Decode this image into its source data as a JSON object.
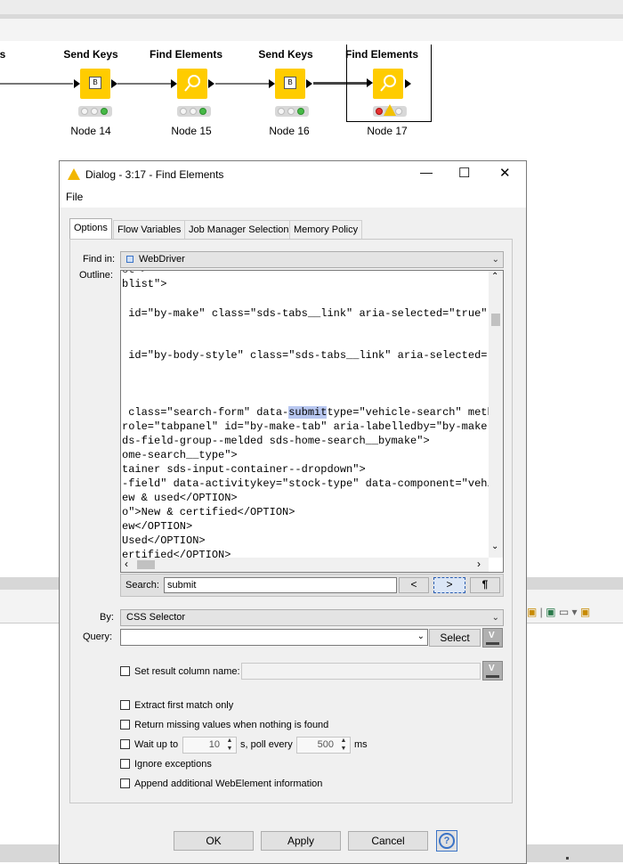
{
  "canvas": {
    "partial_node_title": "s",
    "nodes": [
      {
        "title": "Send Keys",
        "label": "Node 14",
        "icon": "keyboard-icon"
      },
      {
        "title": "Find Elements",
        "label": "Node 15",
        "icon": "find-elements-icon"
      },
      {
        "title": "Send Keys",
        "label": "Node 16",
        "icon": "keyboard-icon"
      },
      {
        "title": "Find Elements",
        "label": "Node 17",
        "icon": "find-elements-icon"
      }
    ]
  },
  "dialog": {
    "title": "Dialog - 3:17 - Find Elements",
    "menu": {
      "file": "File"
    },
    "window_controls": {
      "minimize": "—",
      "maximize": "☐",
      "close": "✕"
    },
    "tabs": [
      "Options",
      "Flow Variables",
      "Job Manager Selection",
      "Memory Policy"
    ],
    "find_in_label": "Find in:",
    "find_in_value": "WebDriver",
    "outline_label": "Outline:",
    "outline_lines": [
      "blist\">",
      " id=\"by-make\" class=\"sds-tabs__link\" aria-selected=\"true\" d",
      " id=\"by-body-style\" class=\"sds-tabs__link\" aria-selected=\"f",
      " class=\"search-form\" data-",
      "submit",
      "type=\"vehicle-search\" metho",
      "role=\"tabpanel\" id=\"by-make-tab\" aria-labelledby=\"by-make\">",
      "ds-field-group--melded sds-home-search__bymake\">",
      "ome-search__type\">",
      "tainer sds-input-container--dropdown\">",
      "-field\" data-activitykey=\"stock-type\" data-component=\"vehic",
      "ew & used</OPTION>",
      "o\">New & certified</OPTION>",
      "ew</OPTION>",
      "Used</OPTION>",
      "ertified</OPTION>"
    ],
    "search_label": "Search:",
    "search_value": "submit",
    "search_prev": "<",
    "search_next": ">",
    "search_pilcrow": "¶",
    "by_label": "By:",
    "by_value": "CSS Selector",
    "query_label": "Query:",
    "query_value": "",
    "select_button": "Select",
    "set_result_column_label": "Set result column name:",
    "extract_first_label": "Extract first match only",
    "return_missing_label": "Return missing values when nothing is found",
    "wait_up_to_label": "Wait up to",
    "wait_value": "10",
    "poll_label": "s, poll every",
    "poll_value": "500",
    "ms_label": "ms",
    "ignore_exceptions_label": "Ignore exceptions",
    "append_info_label": "Append additional WebElement information",
    "ok_button": "OK",
    "apply_button": "Apply",
    "cancel_button": "Cancel",
    "help_button": "?"
  }
}
